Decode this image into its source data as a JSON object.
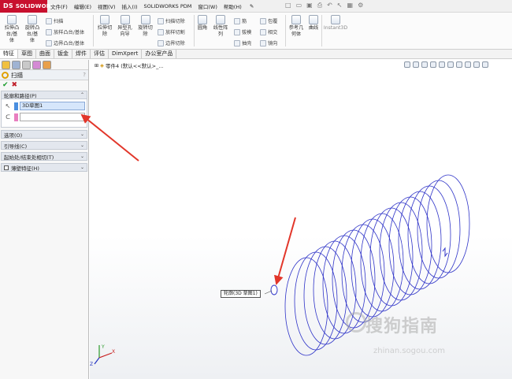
{
  "app": {
    "brand": "SOLIDWORKS",
    "menu": [
      "文件(F)",
      "编辑(E)",
      "视图(V)",
      "插入(I)",
      "SOLIDWORKS PDM",
      "窗口(W)",
      "帮助(H)"
    ]
  },
  "ribbon": {
    "extrude_boss": "拉伸凸\n台/基\n体",
    "revolve_boss": "旋转凸\n台/基\n体",
    "sweep": "扫描",
    "loft": "放样凸台/基体",
    "boundary": "边界凸台/基体",
    "extrude_cut": "拉伸切\n除",
    "hole_wizard": "异型孔\n向导",
    "revolve_cut": "旋转切\n除",
    "swept_cut": "扫描切除",
    "lofted_cut": "放样切割",
    "boundary_cut": "边界切除",
    "fillet": "圆角",
    "linear_pattern": "线性阵\n列",
    "rib": "筋",
    "draft": "拔模",
    "shell": "抽壳",
    "wrap": "包覆",
    "intersect": "相交",
    "mirror": "镜向",
    "ref_geom": "参考几\n何体",
    "curves": "曲线",
    "instant3d": "Instant3D"
  },
  "tabs": [
    "特征",
    "草图",
    "曲面",
    "钣金",
    "焊件",
    "评估",
    "DimXpert",
    "办公室产品"
  ],
  "active_tab": "特征",
  "panel": {
    "title": "扫描",
    "help": "?",
    "ok": "✔",
    "cancel": "✖",
    "profile_group": "轮廓和路径(P)",
    "profile_value": "3D草图1",
    "path_value": "",
    "options_group": "选项(O)",
    "guides_group": "引导线(C)",
    "tangency_group": "起始处/结束处相切(T)",
    "thin_group": "薄壁特征(H)"
  },
  "graphics": {
    "tree_label": "零件4 (默认<<默认>_...",
    "callout": "轮廓(3D 草图1)"
  },
  "watermark": {
    "text": "搜狗指南",
    "url": "zhinan.sogou.com"
  }
}
